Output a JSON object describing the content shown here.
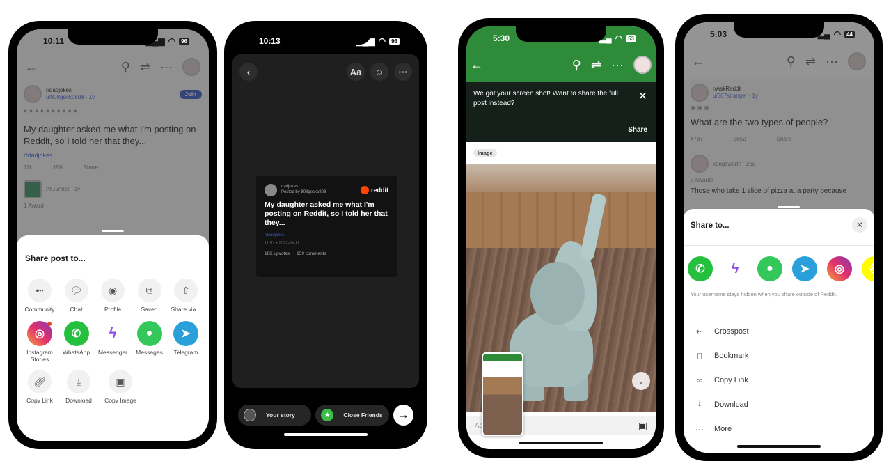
{
  "phone1": {
    "status": {
      "time": "10:11",
      "battery": "96"
    },
    "post": {
      "subreddit": "r/dadjokes",
      "user": "u/808gecko808 · 1y",
      "join_label": "Join",
      "title": "My daughter asked me what I'm posting on Reddit, so I told her that they...",
      "community_link": "r/dadjokes",
      "upvotes": "11k",
      "comments": "159",
      "share_label": "Share",
      "next_user": "AlGunner · 1y",
      "next_awards": "1 Award"
    },
    "sheet": {
      "title": "Share post to...",
      "row1": [
        {
          "label": "Community",
          "icon": "crosspost-icon"
        },
        {
          "label": "Chat",
          "icon": "chat-icon"
        },
        {
          "label": "Profile",
          "icon": "profile-icon"
        },
        {
          "label": "Saved",
          "icon": "saved-icon"
        },
        {
          "label": "Share via...",
          "icon": "share-via-icon"
        }
      ],
      "row2": [
        {
          "label": "Instagram Stories",
          "icon": "instagram-icon"
        },
        {
          "label": "WhatsApp",
          "icon": "whatsapp-icon"
        },
        {
          "label": "Messenger",
          "icon": "messenger-icon"
        },
        {
          "label": "Messages",
          "icon": "messages-icon"
        },
        {
          "label": "Telegram",
          "icon": "telegram-icon"
        }
      ],
      "row3": [
        {
          "label": "Copy Link",
          "icon": "link-icon"
        },
        {
          "label": "Download",
          "icon": "download-icon"
        },
        {
          "label": "Copy Image",
          "icon": "image-icon"
        }
      ]
    }
  },
  "phone2": {
    "status": {
      "time": "10:13",
      "battery": "96"
    },
    "toolbar": {
      "text_label": "Aa"
    },
    "card": {
      "subreddit": "dadjokes",
      "posted_by": "Posted by 808gecko808",
      "brand": "reddit",
      "title": "My daughter asked me what I'm posting on Reddit, so I told her that they...",
      "community": "r/Dadjokes",
      "time": "11:51 • 2022-03-11",
      "upvotes": "18K upvotes",
      "comments": "159 comments"
    },
    "bottom": {
      "your_story": "Your story",
      "close_friends": "Close Friends"
    }
  },
  "phone3": {
    "status": {
      "time": "5:30",
      "battery": "53"
    },
    "toast": {
      "message": "We got your screen shot! Want to share the full post instead?",
      "share_label": "Share"
    },
    "tag": "Image",
    "comment_placeholder": "Add a comment"
  },
  "phone4": {
    "status": {
      "time": "5:03",
      "battery": "44"
    },
    "post": {
      "subreddit": "r/AskReddit",
      "user": "u/567stranger · 1y",
      "title": "What are the two types of people?",
      "upvotes": "4787",
      "comments": "3652",
      "share_label": "Share",
      "commenter": "kongsworth · 26d",
      "awards": "3 Awards",
      "comment_text": "Those who take 1 slice of pizza at a party because"
    },
    "sheet": {
      "title": "Share to...",
      "apps": [
        {
          "name": "WhatsApp",
          "icon": "whatsapp-icon"
        },
        {
          "name": "Messenger",
          "icon": "messenger-icon"
        },
        {
          "name": "Messages",
          "icon": "messages-icon"
        },
        {
          "name": "Telegram",
          "icon": "telegram-icon"
        },
        {
          "name": "Instagram",
          "icon": "instagram-icon"
        },
        {
          "name": "Snapchat",
          "icon": "snapchat-icon"
        }
      ],
      "note": "Your username stays hidden when you share outside of Reddit.",
      "actions": [
        {
          "label": "Crosspost",
          "icon": "crosspost-icon"
        },
        {
          "label": "Bookmark",
          "icon": "bookmark-icon"
        },
        {
          "label": "Copy Link",
          "icon": "link-icon"
        },
        {
          "label": "Download",
          "icon": "download-icon"
        },
        {
          "label": "More",
          "icon": "more-icon"
        }
      ]
    }
  }
}
